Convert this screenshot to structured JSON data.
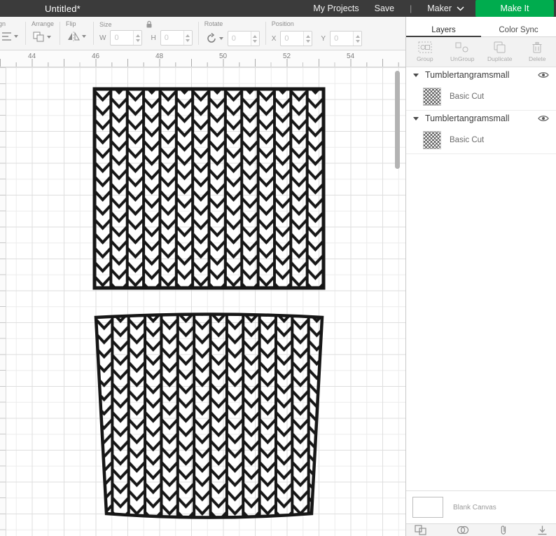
{
  "header": {
    "title": "Untitled*",
    "my_projects": "My Projects",
    "save": "Save",
    "divider": "|",
    "machine": "Maker",
    "make_it": "Make It",
    "colors": {
      "header_bg": "#3b3b3b",
      "make_it_green": "#00AC4E"
    }
  },
  "toolbar": {
    "align": {
      "label": "ign"
    },
    "arrange": {
      "label": "Arrange"
    },
    "flip": {
      "label": "Flip"
    },
    "size": {
      "label": "Size",
      "w_label": "W",
      "w_value": "0",
      "h_label": "H",
      "h_value": "0"
    },
    "rotate": {
      "label": "Rotate",
      "value": "0"
    },
    "position": {
      "label": "Position",
      "x_label": "X",
      "x_value": "0",
      "y_label": "Y",
      "y_value": "0"
    }
  },
  "ruler": {
    "ticks": [
      "44",
      "46",
      "48",
      "50",
      "52",
      "54"
    ]
  },
  "panel": {
    "tabs": [
      {
        "label": "Layers",
        "active": true
      },
      {
        "label": "Color Sync",
        "active": false
      }
    ],
    "actions": [
      {
        "label": "Group",
        "icon": "group-icon"
      },
      {
        "label": "UnGroup",
        "icon": "ungroup-icon"
      },
      {
        "label": "Duplicate",
        "icon": "duplicate-icon"
      },
      {
        "label": "Delete",
        "icon": "trash-icon"
      }
    ],
    "groups": [
      {
        "name": "Tumblertangramsmall",
        "layer": {
          "label": "Basic Cut"
        }
      },
      {
        "name": "Tumblertangramsmall",
        "layer": {
          "label": "Basic Cut"
        }
      }
    ],
    "canvas_info": {
      "label": "Blank Canvas"
    },
    "bottom_icons": [
      "slice-icon",
      "weld-icon",
      "attach-icon",
      "flatten-icon"
    ]
  },
  "canvas": {
    "shape_color": "#161616",
    "shapes": [
      {
        "name": "chevron-pattern-rectangle"
      },
      {
        "name": "chevron-pattern-tumbler-wrap"
      }
    ]
  }
}
